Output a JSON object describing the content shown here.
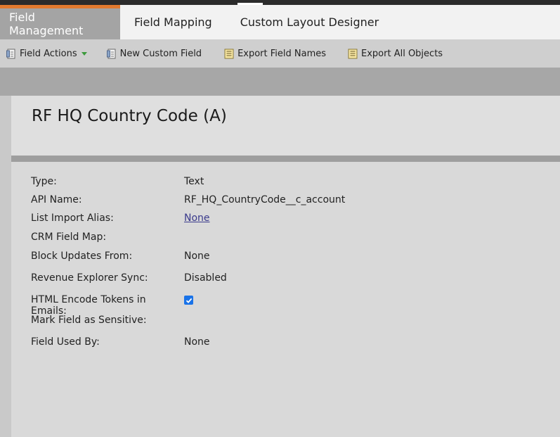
{
  "tabs": [
    {
      "label": "Field Management",
      "active": true
    },
    {
      "label": "Field Mapping",
      "active": false
    },
    {
      "label": "Custom Layout Designer",
      "active": false
    }
  ],
  "toolbar": {
    "field_actions": "Field Actions",
    "new_custom_field": "New Custom Field",
    "export_field_names": "Export Field Names",
    "export_all_objects": "Export All Objects"
  },
  "field": {
    "title": "RF HQ Country Code (A)",
    "rows": [
      {
        "label": "Type:",
        "value": "Text"
      },
      {
        "label": "API Name:",
        "value": "RF_HQ_CountryCode__c_account"
      },
      {
        "label": "List Import Alias:",
        "value": "None"
      },
      {
        "label": "CRM Field Map:",
        "value": ""
      },
      {
        "label": "Block Updates From:",
        "value": "None"
      },
      {
        "label": "Revenue Explorer Sync:",
        "value": "Disabled"
      },
      {
        "label": "HTML Encode Tokens in Emails:",
        "value": "",
        "checked": true
      },
      {
        "label": "Mark Field as Sensitive:",
        "value": ""
      },
      {
        "label": "Field Used By:",
        "value": "None"
      }
    ]
  },
  "colors": {
    "accent": "#e27a2f",
    "active_tab": "#a4a4a4",
    "checkbox": "#1a73e8",
    "link": "#3a3a8c"
  }
}
